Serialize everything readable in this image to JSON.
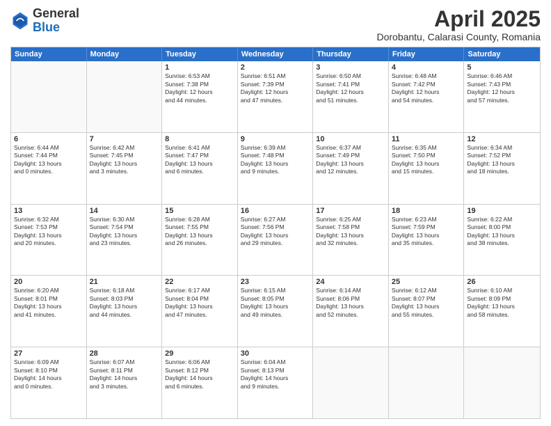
{
  "header": {
    "logo": {
      "general": "General",
      "blue": "Blue"
    },
    "title": "April 2025",
    "location": "Dorobantu, Calarasi County, Romania"
  },
  "calendar": {
    "weekdays": [
      "Sunday",
      "Monday",
      "Tuesday",
      "Wednesday",
      "Thursday",
      "Friday",
      "Saturday"
    ],
    "rows": [
      [
        {
          "day": "",
          "info": ""
        },
        {
          "day": "",
          "info": ""
        },
        {
          "day": "1",
          "info": "Sunrise: 6:53 AM\nSunset: 7:38 PM\nDaylight: 12 hours\nand 44 minutes."
        },
        {
          "day": "2",
          "info": "Sunrise: 6:51 AM\nSunset: 7:39 PM\nDaylight: 12 hours\nand 47 minutes."
        },
        {
          "day": "3",
          "info": "Sunrise: 6:50 AM\nSunset: 7:41 PM\nDaylight: 12 hours\nand 51 minutes."
        },
        {
          "day": "4",
          "info": "Sunrise: 6:48 AM\nSunset: 7:42 PM\nDaylight: 12 hours\nand 54 minutes."
        },
        {
          "day": "5",
          "info": "Sunrise: 6:46 AM\nSunset: 7:43 PM\nDaylight: 12 hours\nand 57 minutes."
        }
      ],
      [
        {
          "day": "6",
          "info": "Sunrise: 6:44 AM\nSunset: 7:44 PM\nDaylight: 13 hours\nand 0 minutes."
        },
        {
          "day": "7",
          "info": "Sunrise: 6:42 AM\nSunset: 7:45 PM\nDaylight: 13 hours\nand 3 minutes."
        },
        {
          "day": "8",
          "info": "Sunrise: 6:41 AM\nSunset: 7:47 PM\nDaylight: 13 hours\nand 6 minutes."
        },
        {
          "day": "9",
          "info": "Sunrise: 6:39 AM\nSunset: 7:48 PM\nDaylight: 13 hours\nand 9 minutes."
        },
        {
          "day": "10",
          "info": "Sunrise: 6:37 AM\nSunset: 7:49 PM\nDaylight: 13 hours\nand 12 minutes."
        },
        {
          "day": "11",
          "info": "Sunrise: 6:35 AM\nSunset: 7:50 PM\nDaylight: 13 hours\nand 15 minutes."
        },
        {
          "day": "12",
          "info": "Sunrise: 6:34 AM\nSunset: 7:52 PM\nDaylight: 13 hours\nand 18 minutes."
        }
      ],
      [
        {
          "day": "13",
          "info": "Sunrise: 6:32 AM\nSunset: 7:53 PM\nDaylight: 13 hours\nand 20 minutes."
        },
        {
          "day": "14",
          "info": "Sunrise: 6:30 AM\nSunset: 7:54 PM\nDaylight: 13 hours\nand 23 minutes."
        },
        {
          "day": "15",
          "info": "Sunrise: 6:28 AM\nSunset: 7:55 PM\nDaylight: 13 hours\nand 26 minutes."
        },
        {
          "day": "16",
          "info": "Sunrise: 6:27 AM\nSunset: 7:56 PM\nDaylight: 13 hours\nand 29 minutes."
        },
        {
          "day": "17",
          "info": "Sunrise: 6:25 AM\nSunset: 7:58 PM\nDaylight: 13 hours\nand 32 minutes."
        },
        {
          "day": "18",
          "info": "Sunrise: 6:23 AM\nSunset: 7:59 PM\nDaylight: 13 hours\nand 35 minutes."
        },
        {
          "day": "19",
          "info": "Sunrise: 6:22 AM\nSunset: 8:00 PM\nDaylight: 13 hours\nand 38 minutes."
        }
      ],
      [
        {
          "day": "20",
          "info": "Sunrise: 6:20 AM\nSunset: 8:01 PM\nDaylight: 13 hours\nand 41 minutes."
        },
        {
          "day": "21",
          "info": "Sunrise: 6:18 AM\nSunset: 8:03 PM\nDaylight: 13 hours\nand 44 minutes."
        },
        {
          "day": "22",
          "info": "Sunrise: 6:17 AM\nSunset: 8:04 PM\nDaylight: 13 hours\nand 47 minutes."
        },
        {
          "day": "23",
          "info": "Sunrise: 6:15 AM\nSunset: 8:05 PM\nDaylight: 13 hours\nand 49 minutes."
        },
        {
          "day": "24",
          "info": "Sunrise: 6:14 AM\nSunset: 8:06 PM\nDaylight: 13 hours\nand 52 minutes."
        },
        {
          "day": "25",
          "info": "Sunrise: 6:12 AM\nSunset: 8:07 PM\nDaylight: 13 hours\nand 55 minutes."
        },
        {
          "day": "26",
          "info": "Sunrise: 6:10 AM\nSunset: 8:09 PM\nDaylight: 13 hours\nand 58 minutes."
        }
      ],
      [
        {
          "day": "27",
          "info": "Sunrise: 6:09 AM\nSunset: 8:10 PM\nDaylight: 14 hours\nand 0 minutes."
        },
        {
          "day": "28",
          "info": "Sunrise: 6:07 AM\nSunset: 8:11 PM\nDaylight: 14 hours\nand 3 minutes."
        },
        {
          "day": "29",
          "info": "Sunrise: 6:06 AM\nSunset: 8:12 PM\nDaylight: 14 hours\nand 6 minutes."
        },
        {
          "day": "30",
          "info": "Sunrise: 6:04 AM\nSunset: 8:13 PM\nDaylight: 14 hours\nand 9 minutes."
        },
        {
          "day": "",
          "info": ""
        },
        {
          "day": "",
          "info": ""
        },
        {
          "day": "",
          "info": ""
        }
      ]
    ]
  }
}
